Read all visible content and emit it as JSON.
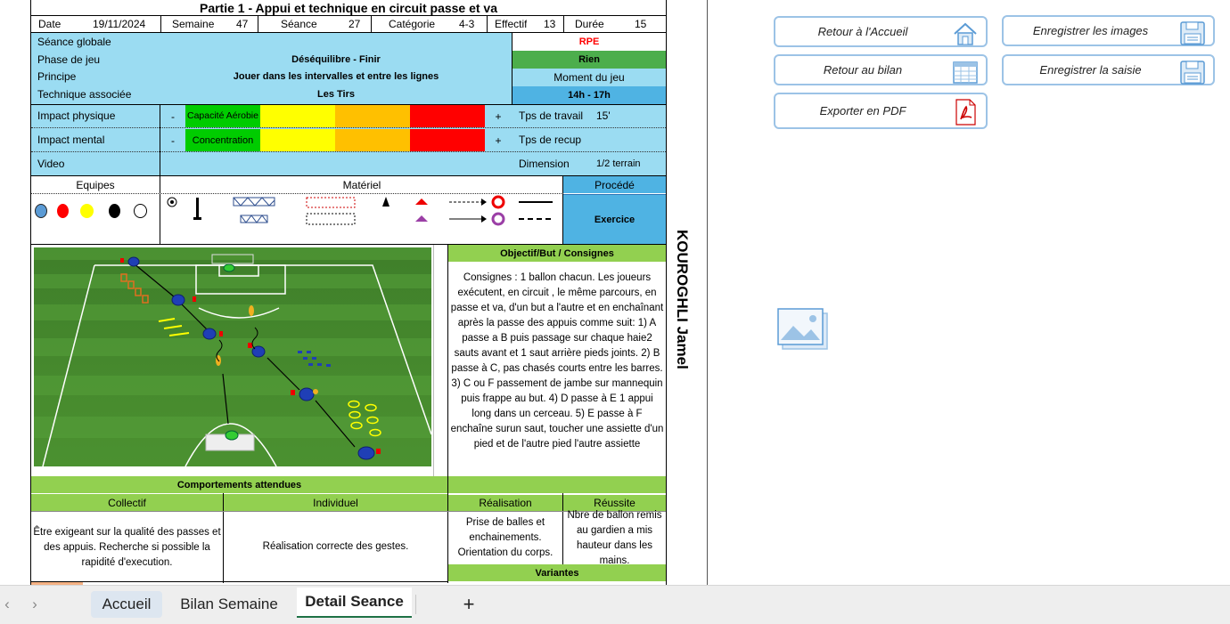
{
  "sheet": {
    "title": "Partie 1 - Appui et technique en circuit passe et va",
    "header": {
      "date_label": "Date",
      "date_value": "19/11/2024",
      "semaine_label": "Semaine",
      "semaine_value": "47",
      "seance_label": "Séance",
      "seance_value": "27",
      "categorie_label": "Catégorie",
      "categorie_value": "4-3",
      "effectif_label": "Effectif",
      "effectif_value": "13",
      "duree_label": "Durée",
      "duree_value": "15"
    },
    "info": {
      "seance_globale": "Séance globale",
      "phase_label": "Phase de jeu",
      "phase_value": "Déséquilibre - Finir",
      "principe_label": "Principe",
      "principe_value": "Jouer dans les intervalles et entre les lignes",
      "technique_label": "Technique associée",
      "technique_value": "Les Tirs",
      "rpe_label": "RPE",
      "rpe_value": "Rien",
      "moment_label": "Moment du jeu",
      "moment_value": "14h - 17h"
    },
    "impact": {
      "physique_label": "Impact physique",
      "physique_value": "Capacité Aérobie",
      "mental_label": "Impact mental",
      "mental_value": "Concentration",
      "minus": "-",
      "plus": "+",
      "video_label": "Video",
      "tps_travail_label": "Tps de travail",
      "tps_travail_value": "15'",
      "tps_recup_label": "Tps de recup",
      "dimension_label": "Dimension",
      "dimension_value": "1/2 terrain"
    },
    "material": {
      "equipes_label": "Equipes",
      "materiel_label": "Matériel",
      "procede_label": "Procédé",
      "procede_value": "Exercice",
      "team_colors": [
        "#5b9bd5",
        "#ff0000",
        "#ffff00",
        "#000000",
        "#ffffff"
      ]
    },
    "objectif": {
      "title": "Objectif/But / Consignes",
      "text": "Consignes : 1 ballon chacun. Les joueurs exécutent, en circuit , le même parcours, en passe et va, d'un but a l'autre et en enchaînant après la passe des appuis comme suit: 1) A passe a B puis passage sur chaque haie2 sauts avant et 1 saut arrière pieds joints. 2) B passe à C, pas chasés courts entre les barres. 3) C ou F passement de jambe sur mannequin puis frappe au but. 4) D passe à E 1 appui long dans un cerceau. 5) E passe à F enchaîne surun saut, toucher une assiette d'un pied et de l'autre pied l'autre assiette"
    },
    "comportements": {
      "title": "Comportements attendues",
      "collectif_label": "Collectif",
      "individuel_label": "Individuel",
      "collectif_text": "Être exigeant sur la qualité des passes et des appuis.  Recherche si possible la rapidité d'execution.",
      "individuel_text": "Réalisation correcte des gestes.",
      "realisation_label": "Réalisation",
      "reussite_label": "Réussite",
      "realisation_text": "Prise de balles et enchainements. Orientation du corps.",
      "reussite_text": "Nbre de ballon remis au gardien a mis hauteur dans les mains.",
      "variantes_label": "Variantes"
    },
    "author": "KOUROGHLI Jamel"
  },
  "buttons": {
    "accueil": "Retour à l'Accueil",
    "images": "Enregistrer les images",
    "bilan": "Retour au bilan",
    "saisie": "Enregistrer la saisie",
    "pdf": "Exporter en PDF"
  },
  "tabs": {
    "items": [
      "Accueil",
      "Bilan Semaine",
      "Detail Seance"
    ],
    "active": "Detail Seance",
    "add": "+",
    "prev": "‹",
    "next": "›"
  }
}
